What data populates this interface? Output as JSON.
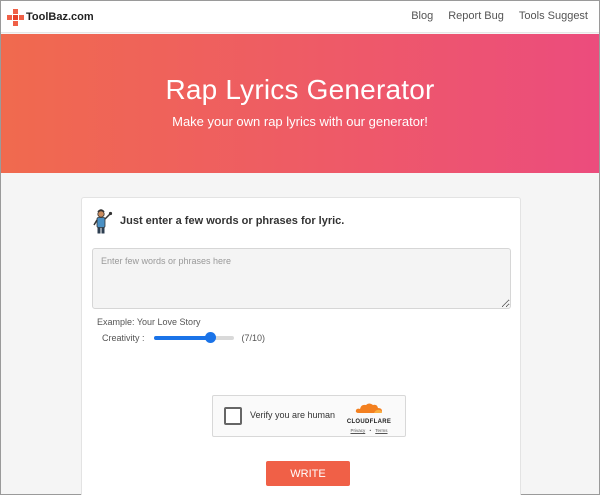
{
  "brand": {
    "name": "ToolBaz.com",
    "logo_icon": "toolbaz-logo-icon"
  },
  "nav": {
    "links": [
      "Blog",
      "Report Bug",
      "Tools Suggest"
    ]
  },
  "hero": {
    "title": "Rap Lyrics Generator",
    "subtitle": "Make your own rap lyrics with our generator!",
    "gradient_colors": [
      "#f06a4e",
      "#ec4c7d"
    ]
  },
  "form": {
    "heading": "Just enter a few words or phrases for lyric.",
    "heading_icon": "rapper-figure-icon",
    "textarea_placeholder": "Enter few words or phrases here",
    "textarea_value": "",
    "example": "Example: Your Love Story",
    "creativity_label": "Creativity :",
    "creativity_value": 7,
    "creativity_max": 10,
    "creativity_display": "(7/10)",
    "accent_color": "#1a73e8"
  },
  "captcha": {
    "label": "Verify you are human",
    "provider": "CLOUDFLARE",
    "privacy": "Privacy",
    "separator": "•",
    "terms": "Terms",
    "icon": "cloudflare-cloud-icon"
  },
  "submit": {
    "label": "WRITE",
    "color": "#f06047"
  }
}
